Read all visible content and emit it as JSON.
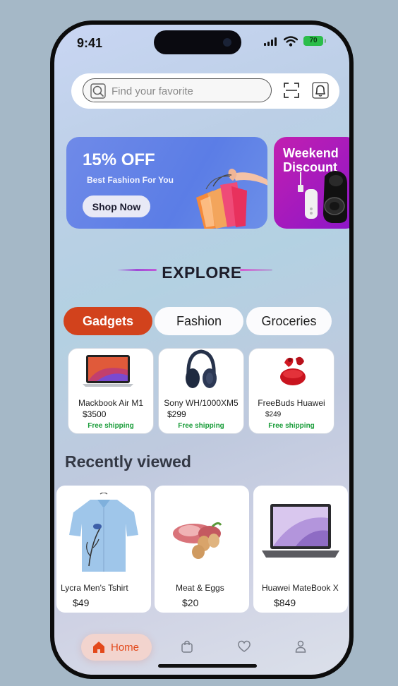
{
  "status": {
    "time": "9:41",
    "battery": "70"
  },
  "search": {
    "placeholder": "Find your favorite"
  },
  "banners": [
    {
      "title": "15% OFF",
      "subtitle": "Best Fashion For You",
      "button": "Shop Now"
    },
    {
      "title": "Weekend Discount"
    }
  ],
  "explore": {
    "title": "EXPLORE"
  },
  "tabs": [
    {
      "label": "Gadgets",
      "active": true
    },
    {
      "label": "Fashion",
      "active": false
    },
    {
      "label": "Groceries",
      "active": false
    }
  ],
  "products": [
    {
      "name": "Mackbook Air M1",
      "price": "$3500",
      "shipping": "Free shipping"
    },
    {
      "name": "Sony WH/1000XM5",
      "price": "$299",
      "shipping": "Free shipping"
    },
    {
      "name": "FreeBuds Huawei",
      "price": "$249",
      "shipping": "Free shipping"
    }
  ],
  "recently_viewed": {
    "title": "Recently viewed",
    "items": [
      {
        "name": "Lycra Men's Tshirt",
        "price": "$49"
      },
      {
        "name": "Meat & Eggs",
        "price": "$20"
      },
      {
        "name": "Huawei MateBook X",
        "price": "$849"
      }
    ]
  },
  "nav": {
    "home_label": "Home",
    "items": [
      "home-icon",
      "bag-icon",
      "heart-icon",
      "user-icon"
    ]
  },
  "colors": {
    "accent": "#d2421c",
    "banner_blue": "#5b7de6",
    "banner_purple": "#b21cb8",
    "shipping_green": "#1a9d3a"
  }
}
